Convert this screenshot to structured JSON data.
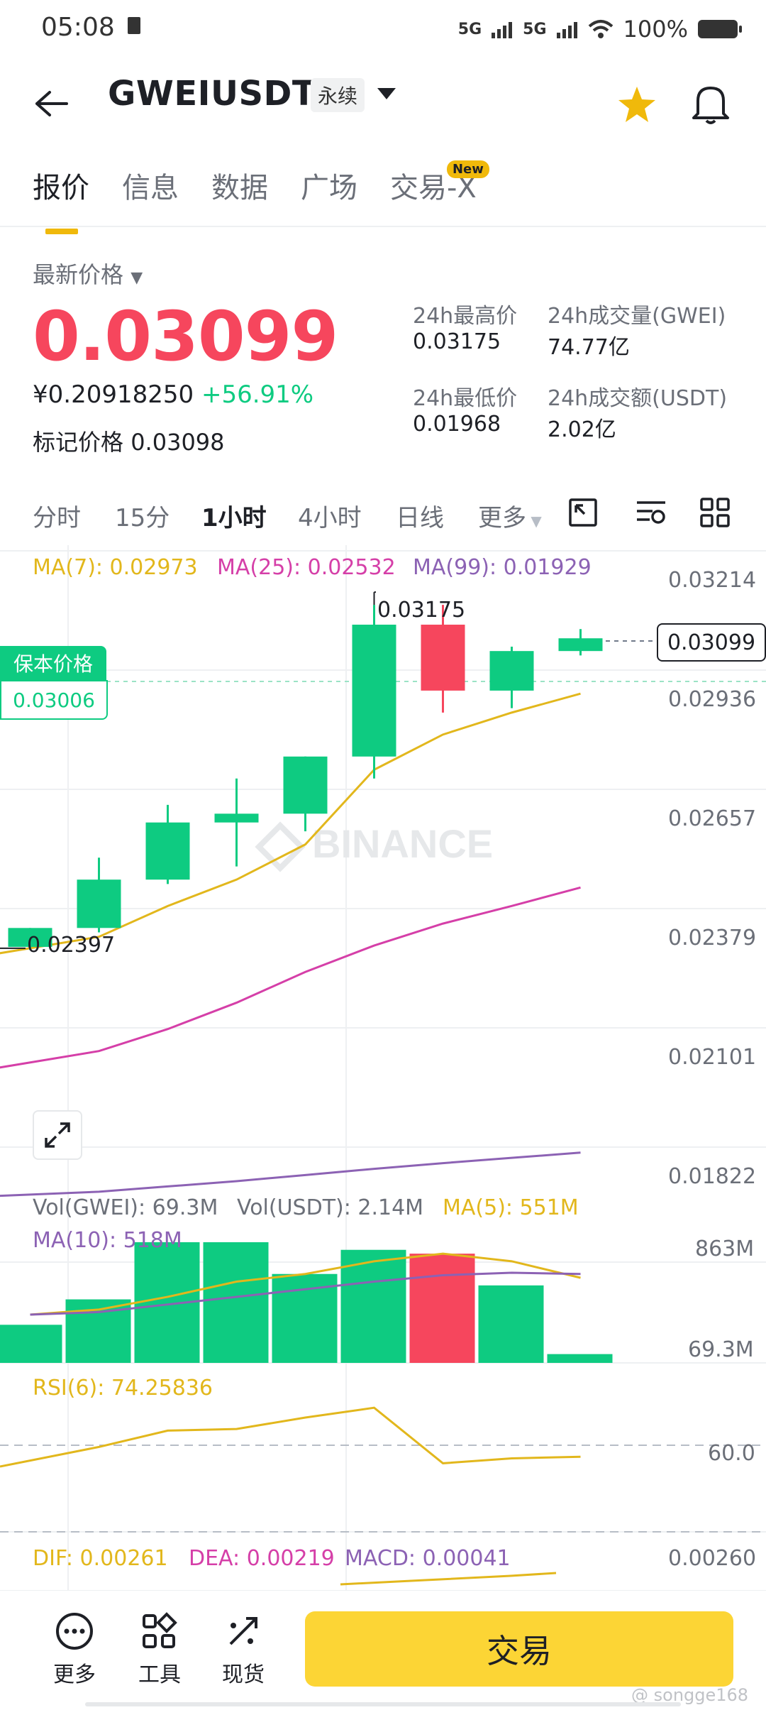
{
  "status_bar": {
    "time": "05:08",
    "signal1": "5G",
    "signal2": "5G",
    "battery": "100%"
  },
  "header": {
    "symbol": "GWEIUSDT",
    "contract_type": "永续"
  },
  "tabs": [
    {
      "label": "报价"
    },
    {
      "label": "信息"
    },
    {
      "label": "数据"
    },
    {
      "label": "广场"
    },
    {
      "label": "交易-X"
    }
  ],
  "new_badge": "New",
  "price": {
    "latest_label": "最新价格",
    "latest": "0.03099",
    "cny": "¥0.20918250",
    "change": "+56.91%",
    "mark_label": "标记价格",
    "mark_value": "0.03098"
  },
  "stats": {
    "high_label": "24h最高价",
    "high": "0.03175",
    "low_label": "24h最低价",
    "low": "0.01968",
    "vol_label": "24h成交量(GWEI)",
    "vol": "74.77亿",
    "amt_label": "24h成交额(USDT)",
    "amt": "2.02亿"
  },
  "intervals": [
    "分时",
    "15分",
    "1小时",
    "4小时",
    "日线",
    "更多"
  ],
  "ma": {
    "ma7": "MA(7): 0.02973",
    "ma25": "MA(25): 0.02532",
    "ma99": "MA(99): 0.01929"
  },
  "y_axis": [
    "0.03214",
    "0.02936",
    "0.02657",
    "0.02379",
    "0.02101",
    "0.01822"
  ],
  "price_labels": {
    "high_mark": "0.03175",
    "low_mark": "0.02397",
    "current": "0.03099"
  },
  "breakeven": {
    "label": "保本价格",
    "value": "0.03006"
  },
  "watermark_text": "BINANCE",
  "vol_indicators": {
    "vol_gwei": "Vol(GWEI): 69.3M",
    "vol_usdt": "Vol(USDT): 2.14M",
    "ma5": "MA(5): 551M",
    "ma10": "MA(10): 518M"
  },
  "vol_axis": {
    "top": "863M",
    "bottom": "69.3M"
  },
  "rsi": {
    "label": "RSI(6): 74.25836",
    "level": "60.0"
  },
  "macd": {
    "dif": "DIF: 0.00261",
    "dea": "DEA: 0.00219",
    "macd": "MACD: 0.00041",
    "axis": "0.00260"
  },
  "bottom": {
    "more": "更多",
    "tools": "工具",
    "spot": "现货",
    "trade": "交易"
  },
  "credit": "@ songge168",
  "colors": {
    "up": "#0ecb81",
    "down": "#f6465d",
    "accent": "#fcd535",
    "ma7": "#e2b71c",
    "ma25": "#d53fa8",
    "ma99": "#8c62b4"
  },
  "chart_data": {
    "type": "candlestick",
    "candles": [
      {
        "o": 0.02397,
        "h": 0.0243,
        "l": 0.0239,
        "c": 0.0244
      },
      {
        "o": 0.0244,
        "h": 0.026,
        "l": 0.0243,
        "c": 0.0255
      },
      {
        "o": 0.0255,
        "h": 0.0272,
        "l": 0.0254,
        "c": 0.0268
      },
      {
        "o": 0.0268,
        "h": 0.0278,
        "l": 0.0258,
        "c": 0.027
      },
      {
        "o": 0.027,
        "h": 0.0282,
        "l": 0.0266,
        "c": 0.0283
      },
      {
        "o": 0.0283,
        "h": 0.03175,
        "l": 0.0278,
        "c": 0.0313
      },
      {
        "o": 0.0313,
        "h": 0.03175,
        "l": 0.0293,
        "c": 0.0298
      },
      {
        "o": 0.0298,
        "h": 0.0308,
        "l": 0.0294,
        "c": 0.0307
      },
      {
        "o": 0.0307,
        "h": 0.0312,
        "l": 0.0306,
        "c": 0.03099
      }
    ],
    "ma7": [
      0.0238,
      0.0242,
      0.0249,
      0.0255,
      0.0263,
      0.028,
      0.0288,
      0.0293,
      0.02973
    ],
    "ma25": [
      0.0212,
      0.0216,
      0.0221,
      0.0227,
      0.0234,
      0.024,
      0.0245,
      0.0249,
      0.02532
    ],
    "ma99": [
      0.0183,
      0.0184,
      0.01852,
      0.01864,
      0.01878,
      0.01892,
      0.01905,
      0.01917,
      0.01929
    ],
    "ylim": [
      0.01822,
      0.03214
    ],
    "volume": [
      300,
      500,
      950,
      950,
      700,
      890,
      860,
      610,
      69.3
    ],
    "volume_ylim": [
      0,
      950
    ],
    "rsi": [
      60.0,
      66.0,
      71.0,
      71.5,
      75.0,
      78.0,
      61.0,
      62.5,
      63.0
    ],
    "rsi_ylim": [
      40,
      90
    ]
  }
}
